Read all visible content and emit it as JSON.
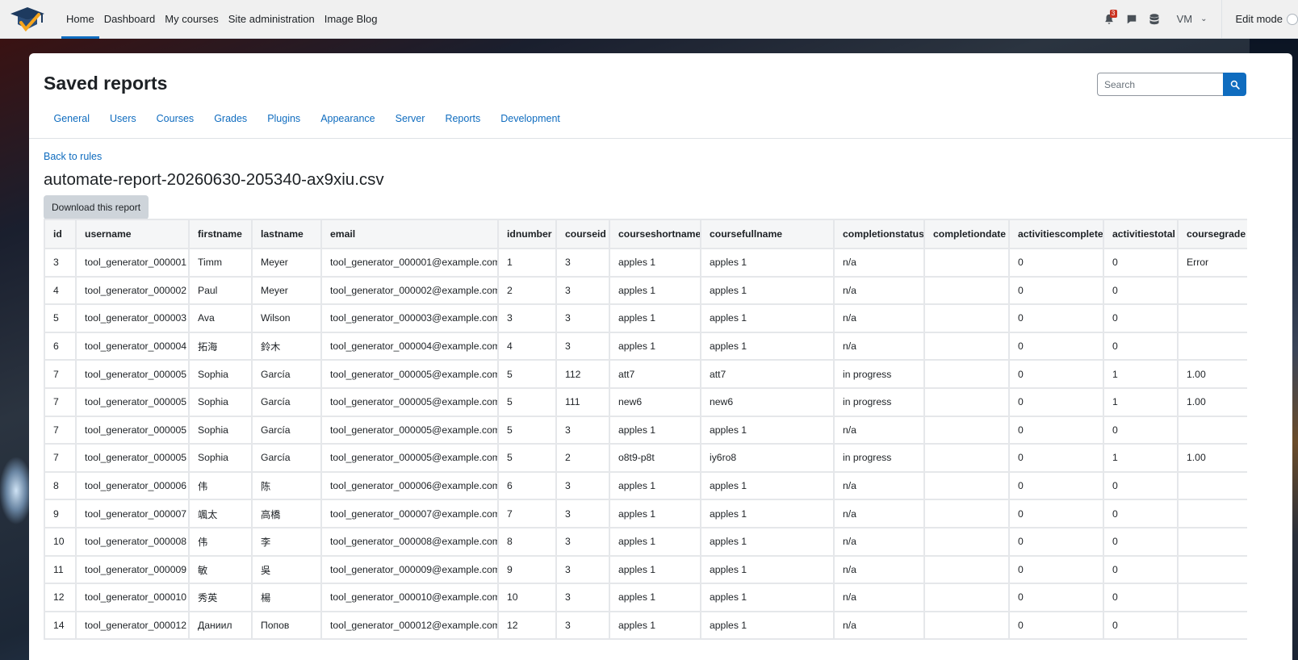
{
  "nav": {
    "links": [
      "Home",
      "Dashboard",
      "My courses",
      "Site administration",
      "Image Blog"
    ],
    "notification_count": "3",
    "user_initials": "VM",
    "edit_mode_label": "Edit mode"
  },
  "page": {
    "title": "Saved reports",
    "search_placeholder": "Search",
    "tabs": [
      "General",
      "Users",
      "Courses",
      "Grades",
      "Plugins",
      "Appearance",
      "Server",
      "Reports",
      "Development"
    ],
    "back_link": "Back to rules",
    "report_filename": "automate-report-20260630-205340-ax9xiu.csv",
    "download_label": "Download this report"
  },
  "table": {
    "columns": [
      "id",
      "username",
      "firstname",
      "lastname",
      "email",
      "idnumber",
      "courseid",
      "courseshortname",
      "coursefullname",
      "completionstatus",
      "completiondate",
      "activitiescomplete",
      "activitiestotal",
      "coursegrade"
    ],
    "rows": [
      [
        "3",
        "tool_generator_000001",
        "Timm",
        "Meyer",
        "tool_generator_000001@example.com",
        "1",
        "3",
        "apples 1",
        "apples 1",
        "n/a",
        "",
        "0",
        "0",
        "Error"
      ],
      [
        "4",
        "tool_generator_000002",
        "Paul",
        "Meyer",
        "tool_generator_000002@example.com",
        "2",
        "3",
        "apples 1",
        "apples 1",
        "n/a",
        "",
        "0",
        "0",
        ""
      ],
      [
        "5",
        "tool_generator_000003",
        "Ava",
        "Wilson",
        "tool_generator_000003@example.com",
        "3",
        "3",
        "apples 1",
        "apples 1",
        "n/a",
        "",
        "0",
        "0",
        ""
      ],
      [
        "6",
        "tool_generator_000004",
        "拓海",
        "鈴木",
        "tool_generator_000004@example.com",
        "4",
        "3",
        "apples 1",
        "apples 1",
        "n/a",
        "",
        "0",
        "0",
        ""
      ],
      [
        "7",
        "tool_generator_000005",
        "Sophia",
        "García",
        "tool_generator_000005@example.com",
        "5",
        "112",
        "att7",
        "att7",
        "in progress",
        "",
        "0",
        "1",
        "1.00"
      ],
      [
        "7",
        "tool_generator_000005",
        "Sophia",
        "García",
        "tool_generator_000005@example.com",
        "5",
        "111",
        "new6",
        "new6",
        "in progress",
        "",
        "0",
        "1",
        "1.00"
      ],
      [
        "7",
        "tool_generator_000005",
        "Sophia",
        "García",
        "tool_generator_000005@example.com",
        "5",
        "3",
        "apples 1",
        "apples 1",
        "n/a",
        "",
        "0",
        "0",
        ""
      ],
      [
        "7",
        "tool_generator_000005",
        "Sophia",
        "García",
        "tool_generator_000005@example.com",
        "5",
        "2",
        "o8t9-p8t",
        "iy6ro8",
        "in progress",
        "",
        "0",
        "1",
        "1.00"
      ],
      [
        "8",
        "tool_generator_000006",
        "伟",
        "陈",
        "tool_generator_000006@example.com",
        "6",
        "3",
        "apples 1",
        "apples 1",
        "n/a",
        "",
        "0",
        "0",
        ""
      ],
      [
        "9",
        "tool_generator_000007",
        "颯太",
        "高橋",
        "tool_generator_000007@example.com",
        "7",
        "3",
        "apples 1",
        "apples 1",
        "n/a",
        "",
        "0",
        "0",
        ""
      ],
      [
        "10",
        "tool_generator_000008",
        "伟",
        "李",
        "tool_generator_000008@example.com",
        "8",
        "3",
        "apples 1",
        "apples 1",
        "n/a",
        "",
        "0",
        "0",
        ""
      ],
      [
        "11",
        "tool_generator_000009",
        "敏",
        "吳",
        "tool_generator_000009@example.com",
        "9",
        "3",
        "apples 1",
        "apples 1",
        "n/a",
        "",
        "0",
        "0",
        ""
      ],
      [
        "12",
        "tool_generator_000010",
        "秀英",
        "楊",
        "tool_generator_000010@example.com",
        "10",
        "3",
        "apples 1",
        "apples 1",
        "n/a",
        "",
        "0",
        "0",
        ""
      ],
      [
        "14",
        "tool_generator_000012",
        "Даниил",
        "Попов",
        "tool_generator_000012@example.com",
        "12",
        "3",
        "apples 1",
        "apples 1",
        "n/a",
        "",
        "0",
        "0",
        ""
      ]
    ]
  },
  "icons": {
    "logo": "graduation-cap-icon",
    "notifications": "bell-icon",
    "messages": "chat-bubble-icon",
    "storage": "database-icon",
    "search": "search-icon"
  },
  "colors": {
    "accent": "#0f6cbf",
    "badge": "#ca3120"
  }
}
